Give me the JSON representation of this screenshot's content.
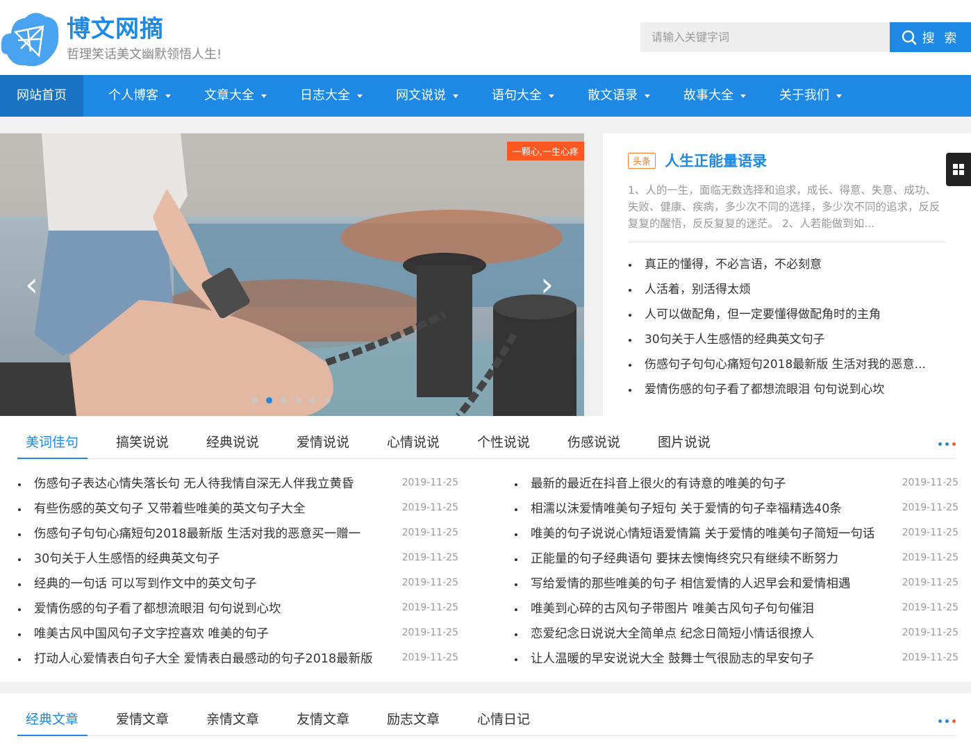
{
  "brand": {
    "title": "博文网摘",
    "subtitle": "哲理笑话美文幽默领悟人生!"
  },
  "search": {
    "placeholder": "请输入关键字词",
    "button_label": "搜 索"
  },
  "nav": {
    "items": [
      {
        "label": "网站首页",
        "active": true
      },
      {
        "label": "个人博客"
      },
      {
        "label": "文章大全"
      },
      {
        "label": "日志大全"
      },
      {
        "label": "网文说说"
      },
      {
        "label": "语句大全"
      },
      {
        "label": "散文语录"
      },
      {
        "label": "故事大全"
      },
      {
        "label": "关于我们"
      }
    ]
  },
  "slider": {
    "tag": "一颗心,一生心疼",
    "dot_count": 6,
    "active_dot": 1
  },
  "headline": {
    "tag": "头条",
    "title": "人生正能量语录",
    "description": "1、人的一生，面临无数选择和追求，成长、得意、失意、成功、失败、健康、疾病，多少次不同的选择，多少次不同的追求，反反复复的醒悟，反反复复的迷茫。 2、人若能做到如...",
    "list": [
      "真正的懂得，不必言语，不必刻意",
      "人活着，别活得太烦",
      "人可以做配角，但一定要懂得做配角时的主角",
      "30句关于人生感悟的经典英文句子",
      "伤感句子句句心痛短句2018最新版 生活对我的恶意...",
      "爱情伤感的句子看了都想流眼泪 句句说到心坎"
    ]
  },
  "section1": {
    "tabs": [
      "美词佳句",
      "搞笑说说",
      "经典说说",
      "爱情说说",
      "心情说说",
      "个性说说",
      "伤感说说",
      "图片说说"
    ],
    "left": [
      {
        "title": "伤感句子表达心情失落长句 无人待我情自深无人伴我立黄昏",
        "date": "2019-11-25"
      },
      {
        "title": "有些伤感的英文句子 又带着些唯美的英文句子大全",
        "date": "2019-11-25"
      },
      {
        "title": "伤感句子句句心痛短句2018最新版 生活对我的恶意买一赠一",
        "date": "2019-11-25"
      },
      {
        "title": "30句关于人生感悟的经典英文句子",
        "date": "2019-11-25"
      },
      {
        "title": "经典的一句话 可以写到作文中的英文句子",
        "date": "2019-11-25"
      },
      {
        "title": "爱情伤感的句子看了都想流眼泪 句句说到心坎",
        "date": "2019-11-25"
      },
      {
        "title": "唯美古风中国风句子文字控喜欢 唯美的句子",
        "date": "2019-11-25"
      },
      {
        "title": "打动人心爱情表白句子大全 爱情表白最感动的句子2018最新版",
        "date": "2019-11-25"
      }
    ],
    "right": [
      {
        "title": "最新的最近在抖音上很火的有诗意的唯美的句子",
        "date": "2019-11-25"
      },
      {
        "title": "相濡以沫爱情唯美句子短句 关于爱情的句子幸福精选40条",
        "date": "2019-11-25"
      },
      {
        "title": "唯美的句子说说心情短语爱情篇 关于爱情的唯美句子简短一句话",
        "date": "2019-11-25"
      },
      {
        "title": "正能量的句子经典语句 要抹去懊悔终究只有继续不断努力",
        "date": "2019-11-25"
      },
      {
        "title": "写给爱情的那些唯美的句子 相信爱情的人迟早会和爱情相遇",
        "date": "2019-11-25"
      },
      {
        "title": "唯美到心碎的古风句子带图片 唯美古风句子句句催泪",
        "date": "2019-11-25"
      },
      {
        "title": "恋爱纪念日说说大全简单点 纪念日简短小情话很撩人",
        "date": "2019-11-25"
      },
      {
        "title": "让人温暖的早安说说大全 鼓舞士气很励志的早安句子",
        "date": "2019-11-25"
      }
    ]
  },
  "section2": {
    "tabs": [
      "经典文章",
      "爱情文章",
      "亲情文章",
      "友情文章",
      "励志文章",
      "心情日记"
    ]
  },
  "colors": {
    "primary": "#1e88e5",
    "nav_active": "#1a72c4",
    "accent_orange": "#ff5722",
    "dots": [
      "#1e88e5",
      "#1e88e5",
      "#ff5722"
    ]
  }
}
